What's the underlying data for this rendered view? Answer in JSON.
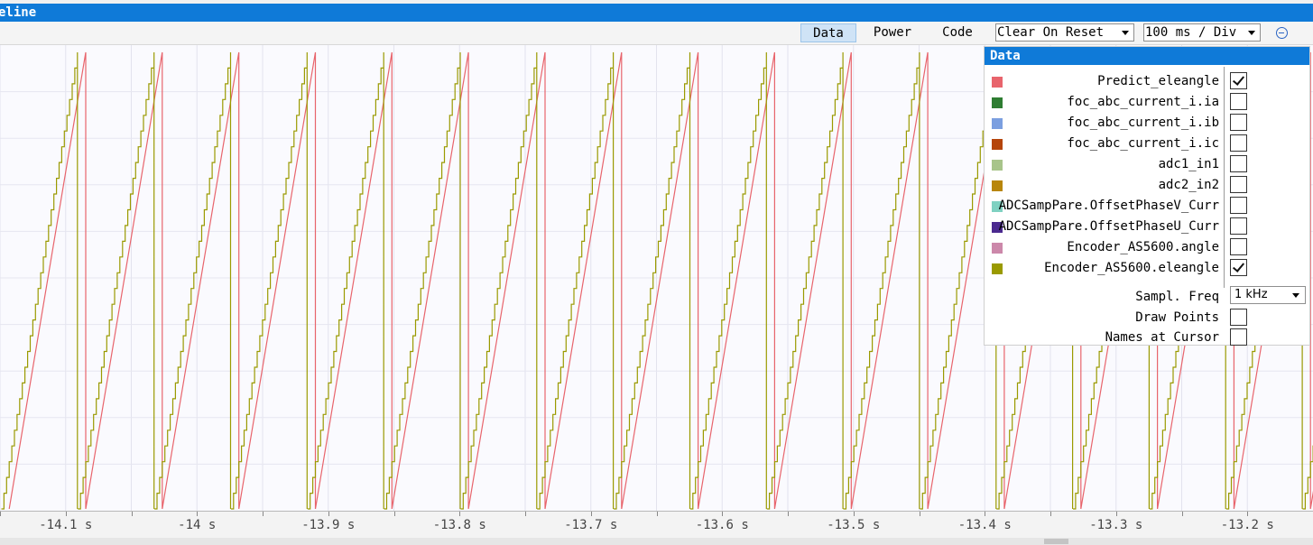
{
  "window": {
    "title": "eline"
  },
  "toolbar": {
    "tabs": [
      {
        "label": "Data",
        "active": true
      },
      {
        "label": "Power",
        "active": false
      },
      {
        "label": "Code",
        "active": false
      }
    ],
    "reset_mode": "Clear On Reset",
    "time_div": "100 ms / Div",
    "remove_icon": "minus-circle-icon"
  },
  "axis": {
    "ticks": [
      "-14.1 s",
      "-14 s",
      "-13.9 s",
      "-13.8 s",
      "-13.7 s",
      "-13.6 s",
      "-13.5 s",
      "-13.4 s",
      "-13.3 s",
      "-13.2 s"
    ]
  },
  "data_panel": {
    "title": "Data",
    "signals": [
      {
        "name": "Predict_eleangle",
        "color": "#e8646c",
        "checked": true
      },
      {
        "name": "foc_abc_current_i.ia",
        "color": "#2e7d32",
        "checked": false
      },
      {
        "name": "foc_abc_current_i.ib",
        "color": "#7b9fe0",
        "checked": false
      },
      {
        "name": "foc_abc_current_i.ic",
        "color": "#b5450b",
        "checked": false
      },
      {
        "name": "adc1_in1",
        "color": "#a8c48a",
        "checked": false
      },
      {
        "name": "adc2_in2",
        "color": "#b8860b",
        "checked": false
      },
      {
        "name": "ADCSampPare.OffsetPhaseV_Curr",
        "color": "#7fd1c1",
        "checked": false
      },
      {
        "name": "ADCSampPare.OffsetPhaseU_Curr",
        "color": "#4b2a8f",
        "checked": false
      },
      {
        "name": "Encoder_AS5600.angle",
        "color": "#cc88aa",
        "checked": false
      },
      {
        "name": "Encoder_AS5600.eleangle",
        "color": "#9a9a00",
        "checked": true
      }
    ],
    "sampl_freq_label": "Sampl. Freq",
    "sampl_freq_value": "1 kHz",
    "draw_points_label": "Draw Points",
    "draw_points": false,
    "names_at_cursor_label": "Names at Cursor",
    "names_at_cursor": false
  },
  "chart_data": {
    "type": "line",
    "x_range_s": [
      -14.15,
      -13.15
    ],
    "sample_period_s": 0.001,
    "sawtooth_period_s": 0.0583,
    "series": [
      {
        "name": "Encoder_AS5600.eleangle",
        "color": "#9a9a00",
        "first_reset_s": -14.149,
        "step_s": 0.002
      },
      {
        "name": "Predict_eleangle",
        "color": "#e8646c",
        "first_reset_s": -14.143
      }
    ]
  }
}
